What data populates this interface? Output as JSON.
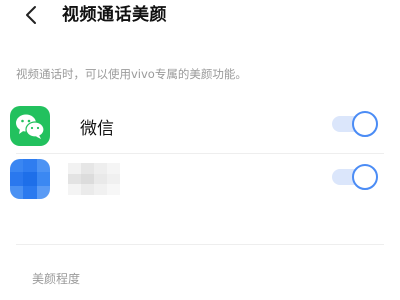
{
  "header": {
    "back_icon": "chevron-left-icon",
    "title": "视频通话美颜"
  },
  "description": "视频通话时，可以使用vivo专属的美颜功能。",
  "apps": [
    {
      "name": "微信",
      "icon": "wechat-icon",
      "enabled": true,
      "icon_color": "#22c15e"
    },
    {
      "name": "",
      "icon": "blurred-app-icon",
      "enabled": true,
      "icon_color": "#2f7df0"
    }
  ],
  "toggle_colors": {
    "track_on": "#dbe6fb",
    "knob_border": "#4b8cf5"
  },
  "section_label": "美颜程度"
}
